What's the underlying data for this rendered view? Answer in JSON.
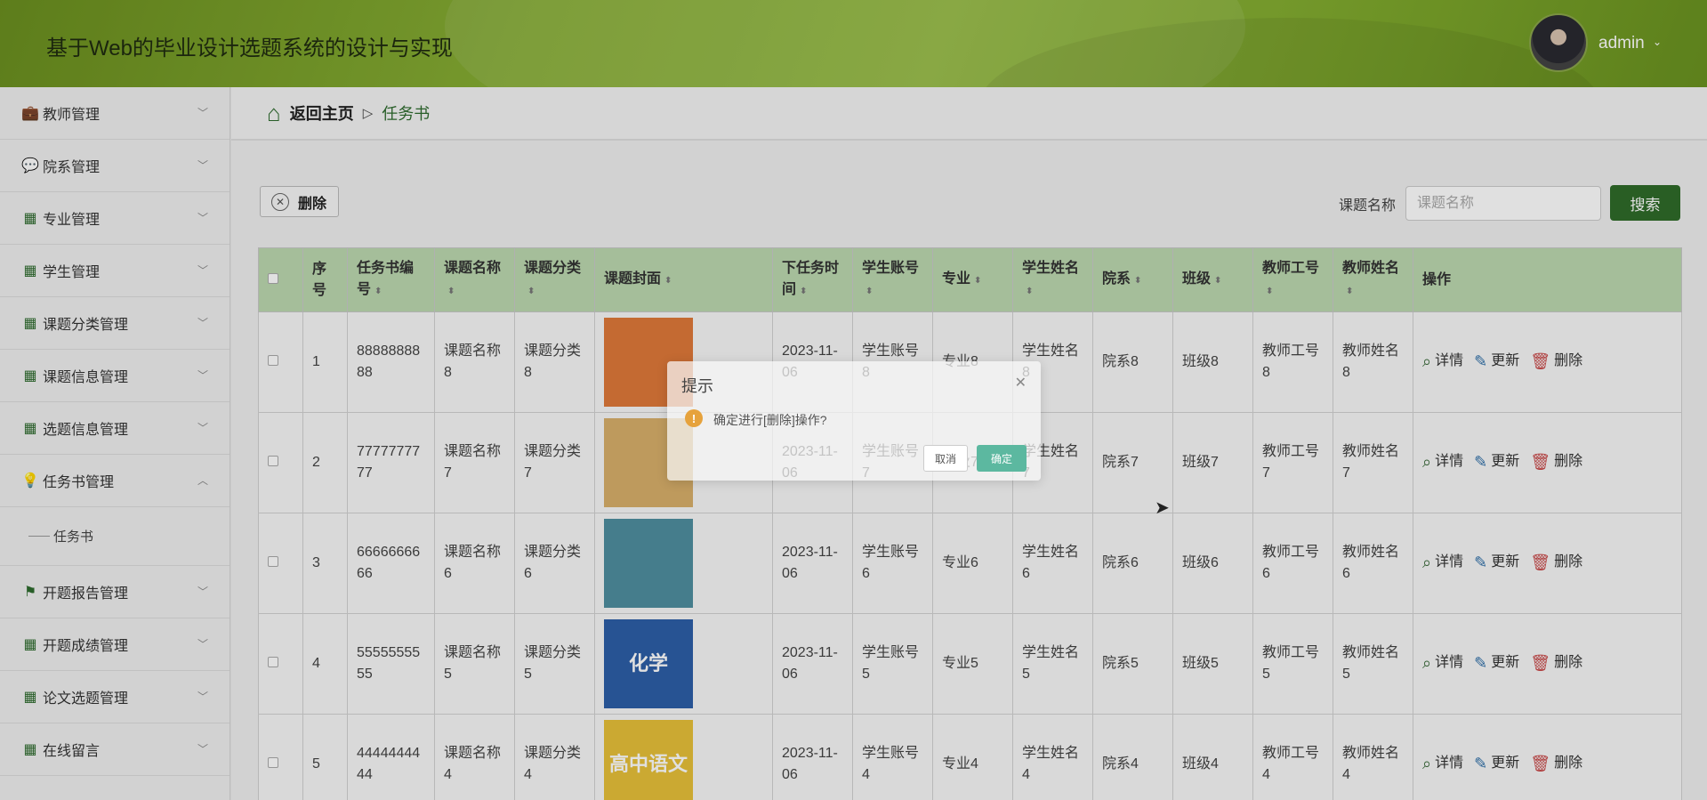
{
  "header": {
    "title": "基于Web的毕业设计选题系统的设计与实现",
    "user": "admin"
  },
  "sidebar": {
    "items": [
      {
        "label": "教师管理",
        "icon": "briefcase-icon",
        "glyph": "💼"
      },
      {
        "label": "院系管理",
        "icon": "chat-icon",
        "glyph": "💬"
      },
      {
        "label": "专业管理",
        "icon": "grid-icon",
        "glyph": "▦"
      },
      {
        "label": "学生管理",
        "icon": "grid-icon",
        "glyph": "▦"
      },
      {
        "label": "课题分类管理",
        "icon": "grid-icon",
        "glyph": "▦"
      },
      {
        "label": "课题信息管理",
        "icon": "grid-icon",
        "glyph": "▦"
      },
      {
        "label": "选题信息管理",
        "icon": "grid-icon",
        "glyph": "▦"
      },
      {
        "label": "任务书管理",
        "icon": "bulb-icon",
        "glyph": "💡"
      },
      {
        "label": "开题报告管理",
        "icon": "flag-icon",
        "glyph": "⚑"
      },
      {
        "label": "开题成绩管理",
        "icon": "grid-icon",
        "glyph": "▦"
      },
      {
        "label": "论文选题管理",
        "icon": "grid-icon",
        "glyph": "▦"
      },
      {
        "label": "在线留言",
        "icon": "grid-icon",
        "glyph": "▦"
      }
    ],
    "sub_item": "任务书"
  },
  "breadcrumb": {
    "home": "返回主页",
    "separator": "▷",
    "current": "任务书"
  },
  "toolbar": {
    "delete_label": "删除",
    "search_label": "课题名称",
    "search_placeholder": "课题名称",
    "search_button": "搜索"
  },
  "table": {
    "headers": [
      "序号",
      "任务书编号",
      "课题名称",
      "课题分类",
      "课题封面",
      "下任务时间",
      "学生账号",
      "专业",
      "学生姓名",
      "院系",
      "班级",
      "教师工号",
      "教师姓名",
      "操作"
    ],
    "actions": {
      "detail": "详情",
      "update": "更新",
      "delete": "删除"
    },
    "rows": [
      {
        "no": "1",
        "code": "8888888888",
        "topic": "课题名称8",
        "category": "课题分类8",
        "cover_text": "",
        "cover_color": "#e0793a",
        "time": "2023-11-06",
        "account": "学生账号8",
        "major": "专业8",
        "name": "学生姓名8",
        "dept": "院系8",
        "cls": "班级8",
        "tno": "教师工号8",
        "tname": "教师姓名8"
      },
      {
        "no": "2",
        "code": "7777777777",
        "topic": "课题名称7",
        "category": "课题分类7",
        "cover_text": "",
        "cover_color": "#d9b06a",
        "time": "2023-11-06",
        "account": "学生账号7",
        "major": "专业7",
        "name": "学生姓名7",
        "dept": "院系7",
        "cls": "班级7",
        "tno": "教师工号7",
        "tname": "教师姓名7"
      },
      {
        "no": "3",
        "code": "6666666666",
        "topic": "课题名称6",
        "category": "课题分类6",
        "cover_text": "",
        "cover_color": "#4f8fa0",
        "time": "2023-11-06",
        "account": "学生账号6",
        "major": "专业6",
        "name": "学生姓名6",
        "dept": "院系6",
        "cls": "班级6",
        "tno": "教师工号6",
        "tname": "教师姓名6"
      },
      {
        "no": "4",
        "code": "5555555555",
        "topic": "课题名称5",
        "category": "课题分类5",
        "cover_text": "化学",
        "cover_color": "#2d5fa8",
        "time": "2023-11-06",
        "account": "学生账号5",
        "major": "专业5",
        "name": "学生姓名5",
        "dept": "院系5",
        "cls": "班级5",
        "tno": "教师工号5",
        "tname": "教师姓名5"
      },
      {
        "no": "5",
        "code": "4444444444",
        "topic": "课题名称4",
        "category": "课题分类4",
        "cover_text": "高中语文",
        "cover_color": "#e8c13a",
        "time": "2023-11-06",
        "account": "学生账号4",
        "major": "专业4",
        "name": "学生姓名4",
        "dept": "院系4",
        "cls": "班级4",
        "tno": "教师工号4",
        "tname": "教师姓名4"
      }
    ]
  },
  "dialog": {
    "title": "提示",
    "message": "确定进行[删除]操作?",
    "cancel": "取消",
    "confirm": "确定"
  }
}
